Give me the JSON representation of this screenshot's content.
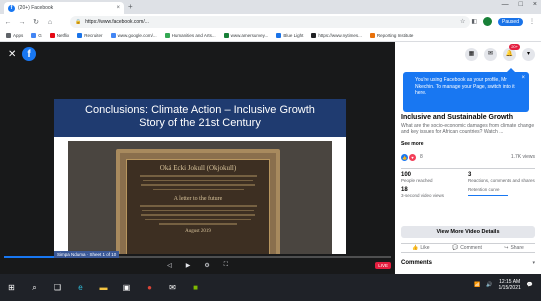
{
  "browser": {
    "tab_title": "(20+) Facebook",
    "url": "https://www.facebook.com/...",
    "paused_label": "Paused",
    "bookmarks": [
      {
        "label": "Apps",
        "color": "#5f6368"
      },
      {
        "label": "G",
        "color": "#4285f4"
      },
      {
        "label": "Netflix",
        "color": "#e50914"
      },
      {
        "label": "Recruiter",
        "color": "#1a73e8"
      },
      {
        "label": "www.google.com/...",
        "color": "#4285f4"
      },
      {
        "label": "Humanities and Arts...",
        "color": "#34a853"
      },
      {
        "label": "www.amersurvey...",
        "color": "#188038"
      },
      {
        "label": "Blue Light",
        "color": "#1a73e8"
      },
      {
        "label": "https://www.nytimes...",
        "color": "#202124"
      },
      {
        "label": "Reporting Institute",
        "color": "#e8710a"
      }
    ]
  },
  "video": {
    "slide_title_line1": "Conclusions: Climate Action – Inclusive Growth",
    "slide_title_line2": "Story of the 21st Century",
    "plaque_heading": "Oká Ecki Jokull (Okjokull)",
    "plaque_subheading": "A letter to the future",
    "plaque_footer": "August 2019",
    "caption": "Simpa Nduma · Sheet 1 of 10",
    "progress": 0.25,
    "live_badge": "LIVE"
  },
  "panel": {
    "tooltip": "You're using Facebook as your profile, Mr Nkechin. To manage your Page, switch into it here.",
    "notifications_badge": "20+",
    "post_title": "Inclusive and Sustainable Growth",
    "post_desc": "What are the socio-economic damages from climate change and key issues for African countries? Watch ...",
    "see_more": "See more",
    "reaction_count": "8",
    "views": "1.7K views",
    "stats": [
      {
        "num": "100",
        "label": "People reached"
      },
      {
        "num": "3",
        "label": "Reactions, comments and shares"
      },
      {
        "num": "18",
        "label": "3-second video views"
      },
      {
        "num": "",
        "label": "Retention curve"
      }
    ],
    "details_button": "View More Video Details",
    "actions": {
      "like": "Like",
      "comment": "Comment",
      "share": "Share"
    },
    "comments_label": "Comments"
  },
  "taskbar": {
    "time": "12:15 AM",
    "date": "1/15/2021"
  }
}
